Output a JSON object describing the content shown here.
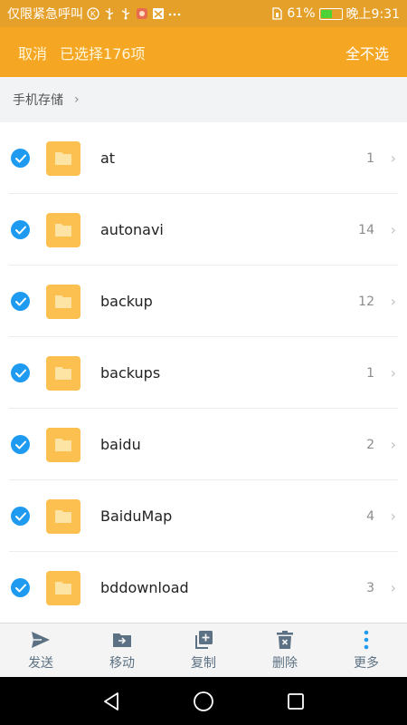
{
  "status_bar": {
    "carrier": "仅限紧急呼叫",
    "battery_percent": "61%",
    "battery_level": 0.61,
    "time": "晚上9:31",
    "icons": [
      "k-circle-icon",
      "usb-icon",
      "usb-icon",
      "app-notification-icon",
      "photo-notification-icon",
      "more-dots-icon",
      "battery-icon"
    ]
  },
  "top_bar": {
    "cancel_label": "取消",
    "selected_count_label": "已选择176项",
    "deselect_all_label": "全不选"
  },
  "breadcrumb": {
    "location": "手机存储",
    "chevron": "›"
  },
  "files": [
    {
      "name": "at",
      "count": "1",
      "checked": true
    },
    {
      "name": "autonavi",
      "count": "14",
      "checked": true
    },
    {
      "name": "backup",
      "count": "12",
      "checked": true
    },
    {
      "name": "backups",
      "count": "1",
      "checked": true
    },
    {
      "name": "baidu",
      "count": "2",
      "checked": true
    },
    {
      "name": "BaiduMap",
      "count": "4",
      "checked": true
    },
    {
      "name": "bddownload",
      "count": "3",
      "checked": true
    }
  ],
  "row_chevron": "›",
  "bottom_toolbar": {
    "send": "发送",
    "move": "移动",
    "copy": "复制",
    "delete": "删除",
    "more": "更多"
  },
  "colors": {
    "accent": "#f5a623",
    "status_bar": "#e5a02a",
    "check": "#1e9bf0",
    "folder": "#fbc04f",
    "toolbar_icon": "#5c7183"
  }
}
